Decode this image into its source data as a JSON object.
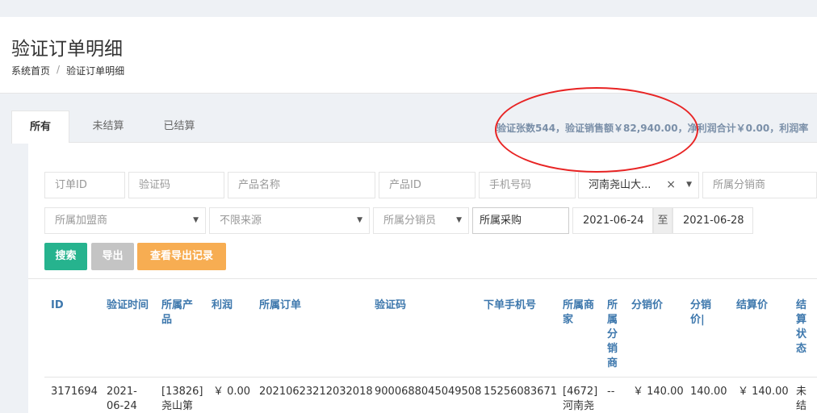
{
  "page": {
    "title": "验证订单明细",
    "breadcrumb": [
      "系统首页",
      "/",
      "验证订单明细"
    ]
  },
  "tabs": [
    {
      "label": "所有",
      "active": true
    },
    {
      "label": "未结算",
      "active": false
    },
    {
      "label": "已结算",
      "active": false
    }
  ],
  "summary": "验证张数544，验证销售额￥82,940.00，净利润合计￥0.00，利润率",
  "filters": {
    "order_id_placeholder": "订单ID",
    "code_placeholder": "验证码",
    "product_name_placeholder": "产品名称",
    "product_id_placeholder": "产品ID",
    "phone_placeholder": "手机号码",
    "merchant_value": "河南尧山大...",
    "distributor_placeholder": "所属分销商",
    "franchisee_placeholder": "所属加盟商",
    "source_value": "不限来源",
    "salesperson_placeholder": "所属分销员",
    "purchase_placeholder": "所属采购",
    "date_from": "2021-06-24",
    "date_sep": "至",
    "date_to": "2021-06-28"
  },
  "buttons": {
    "search": "搜索",
    "export": "导出",
    "records": "查看导出记录"
  },
  "table": {
    "headers": {
      "id": "ID",
      "verify_time": "验证时间",
      "product_1": "所属产",
      "product_2": "品",
      "profit": "利润",
      "order": "所属订单",
      "code": "验证码",
      "phone": "下单手机号",
      "merchant_1": "所属商",
      "merchant_2": "家",
      "dist_1": "所",
      "dist_2": "属",
      "dist_3": "分",
      "dist_4": "销",
      "dist_5": "商",
      "dist_price": "分销价",
      "dist_price2_1": "分销",
      "dist_price2_2": "价|",
      "settle_price": "结算价",
      "status_1": "结",
      "status_2": "算",
      "status_3": "状",
      "status_4": "态"
    },
    "row": {
      "id": "3171694",
      "time_1": "2021-",
      "time_2": "06-24",
      "product_1": "[13826]",
      "product_2": "尧山第",
      "profit": "￥ 0.00",
      "order": "20210623212032018",
      "code": "9000688045049508",
      "phone": "15256083671",
      "merchant_1": "[4672]",
      "merchant_2": "河南尧",
      "dist": "--",
      "dist_price": "￥ 140.00",
      "dist_price2": "140.00",
      "settle_price": "￥ 140.00",
      "status_1": "未",
      "status_2": "结"
    }
  }
}
